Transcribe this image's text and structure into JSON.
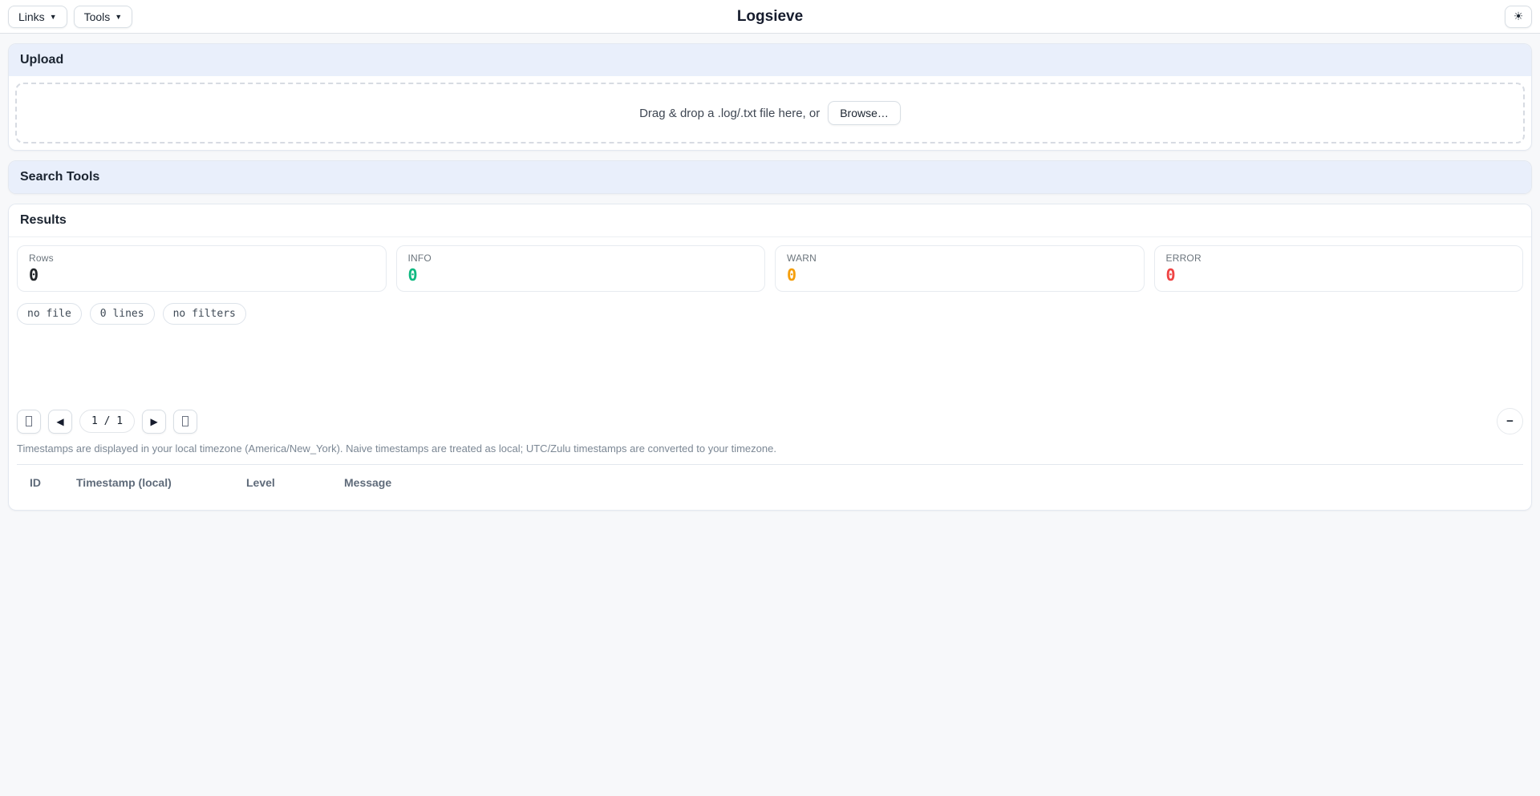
{
  "topbar": {
    "links": {
      "label": "Links",
      "caret": "▼"
    },
    "tools": {
      "label": "Tools",
      "caret": "▼"
    },
    "title": "Logsieve",
    "theme_icon": "☀"
  },
  "upload": {
    "header": "Upload",
    "dropzone_text": "Drag & drop a .log/.txt file here, or",
    "browse_label": "Browse…"
  },
  "search_tools": {
    "header": "Search Tools"
  },
  "results": {
    "header": "Results",
    "stats": [
      {
        "label": "Rows",
        "value": "0",
        "color": "#212529"
      },
      {
        "label": "INFO",
        "value": "0",
        "color": "#10b981"
      },
      {
        "label": "WARN",
        "value": "0",
        "color": "#f59e0b"
      },
      {
        "label": "ERROR",
        "value": "0",
        "color": "#ef4444"
      }
    ],
    "chips": [
      "no file",
      "0 lines",
      "no filters"
    ],
    "pagination": {
      "prev_icon": "◀",
      "next_icon": "▶",
      "page_indicator": "1 / 1",
      "collapse_icon": "−"
    },
    "timezone_note": "Timestamps are displayed in your local timezone (America/New_York). Naive timestamps are treated as local; UTC/Zulu timestamps are converted to your timezone.",
    "table": {
      "columns": [
        "ID",
        "Timestamp (local)",
        "Level",
        "Message"
      ]
    }
  }
}
